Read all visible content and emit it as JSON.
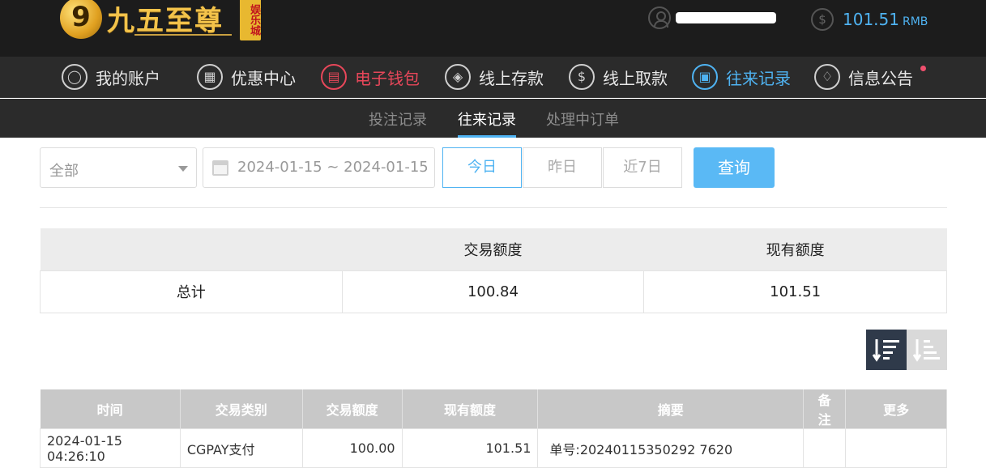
{
  "brand": {
    "logo_mark": "9",
    "name": "九五至尊",
    "badge": "娱乐城"
  },
  "account": {
    "balance": "101.51",
    "currency": "RMB"
  },
  "nav": {
    "items": [
      {
        "label": "我的账户",
        "icon": "user-icon",
        "glyph": "◯"
      },
      {
        "label": "优惠中心",
        "icon": "gift-icon",
        "glyph": "▦"
      },
      {
        "label": "电子钱包",
        "icon": "wallet-icon",
        "glyph": "▤"
      },
      {
        "label": "线上存款",
        "icon": "deposit-icon",
        "glyph": "◈"
      },
      {
        "label": "线上取款",
        "icon": "withdraw-icon",
        "glyph": "$"
      },
      {
        "label": "往来记录",
        "icon": "records-icon",
        "glyph": "▣"
      },
      {
        "label": "信息公告",
        "icon": "bell-icon",
        "glyph": "♢"
      }
    ]
  },
  "subnav": {
    "tabs": [
      "投注记录",
      "往来记录",
      "处理中订单"
    ]
  },
  "filters": {
    "category": "全部",
    "date_range": "2024-01-15 ~ 2024-01-15",
    "quick": [
      "今日",
      "昨日",
      "近7日"
    ],
    "query_label": "查询"
  },
  "summary": {
    "headers": [
      "",
      "交易额度",
      "现有额度"
    ],
    "row_label": "总计",
    "trade_amount": "100.84",
    "current_amount": "101.51"
  },
  "records": {
    "headers": [
      "时间",
      "交易类别",
      "交易额度",
      "现有额度",
      "摘要",
      "备注",
      "更多"
    ],
    "rows": [
      {
        "time": "2024-01-15 04:26:10",
        "type": "CGPAY支付",
        "amount": "100.00",
        "balance": "101.51",
        "summary": "单号:20240115350292 7620",
        "remark": "",
        "more": ""
      }
    ]
  },
  "colors": {
    "accent_blue": "#4fb3f2",
    "accent_red": "#e8475a",
    "header_bg": "#1c1c1c",
    "nav_bg": "#2b2b2b"
  }
}
